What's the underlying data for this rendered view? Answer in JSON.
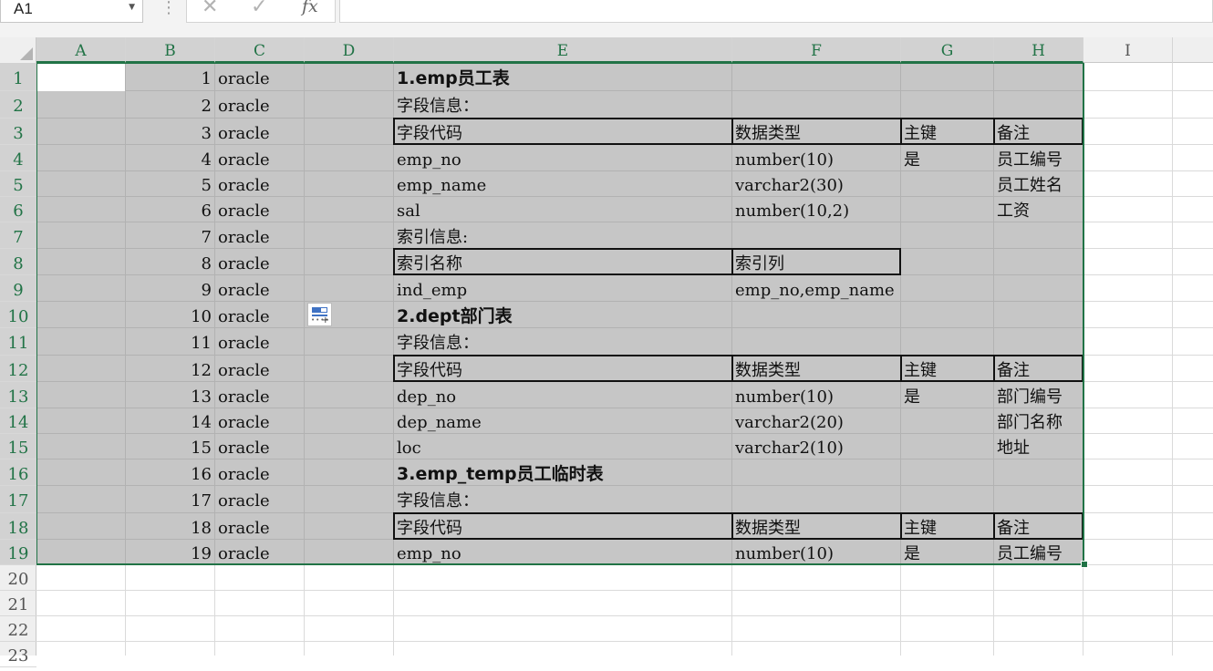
{
  "formula_bar": {
    "name_box": "A1",
    "cancel_icon": "✕",
    "enter_icon": "✓",
    "fx_label": "fx",
    "formula": ""
  },
  "columns": [
    "A",
    "B",
    "C",
    "D",
    "E",
    "F",
    "G",
    "H",
    "I"
  ],
  "rows": [
    "1",
    "2",
    "3",
    "4",
    "5",
    "6",
    "7",
    "8",
    "9",
    "10",
    "11",
    "12",
    "13",
    "14",
    "15",
    "16",
    "17",
    "18",
    "19",
    "20",
    "21",
    "22",
    "23"
  ],
  "cells": {
    "B": [
      "1",
      "2",
      "3",
      "4",
      "5",
      "6",
      "7",
      "8",
      "9",
      "10",
      "11",
      "12",
      "13",
      "14",
      "15",
      "16",
      "17",
      "18",
      "19"
    ],
    "C": [
      "oracle",
      "oracle",
      "oracle",
      "oracle",
      "oracle",
      "oracle",
      "oracle",
      "oracle",
      "oracle",
      "oracle",
      "oracle",
      "oracle",
      "oracle",
      "oracle",
      "oracle",
      "oracle",
      "oracle",
      "oracle",
      "oracle"
    ],
    "E": [
      "1.emp员工表",
      "字段信息：",
      "字段代码",
      "emp_no",
      "emp_name",
      "sal",
      "索引信息:",
      "索引名称",
      "ind_emp",
      "2.dept部门表",
      "字段信息：",
      "字段代码",
      "dep_no",
      "dep_name",
      "loc",
      "3.emp_temp员工临时表",
      "字段信息：",
      "字段代码",
      "emp_no"
    ],
    "F": [
      "",
      "",
      "数据类型",
      "number(10)",
      "varchar2(30)",
      "number(10,2)",
      "",
      "索引列",
      "emp_no,emp_name",
      "",
      "",
      "数据类型",
      "number(10)",
      "varchar2(20)",
      "varchar2(10)",
      "",
      "",
      "数据类型",
      "number(10)"
    ],
    "G": [
      "",
      "",
      "主键",
      "是",
      "",
      "",
      "",
      "",
      "",
      "",
      "",
      "主键",
      "是",
      "",
      "",
      "",
      "",
      "主键",
      "是"
    ],
    "H": [
      "",
      "",
      "备注",
      "员工编号",
      "员工姓名",
      "工资",
      "",
      "",
      "",
      "",
      "",
      "备注",
      "部门编号",
      "部门名称",
      "地址",
      "",
      "",
      "备注",
      "员工编号"
    ]
  },
  "colors": {
    "accent": "#217346",
    "selection": "#c6c6c6",
    "header_bg": "#efefef"
  }
}
